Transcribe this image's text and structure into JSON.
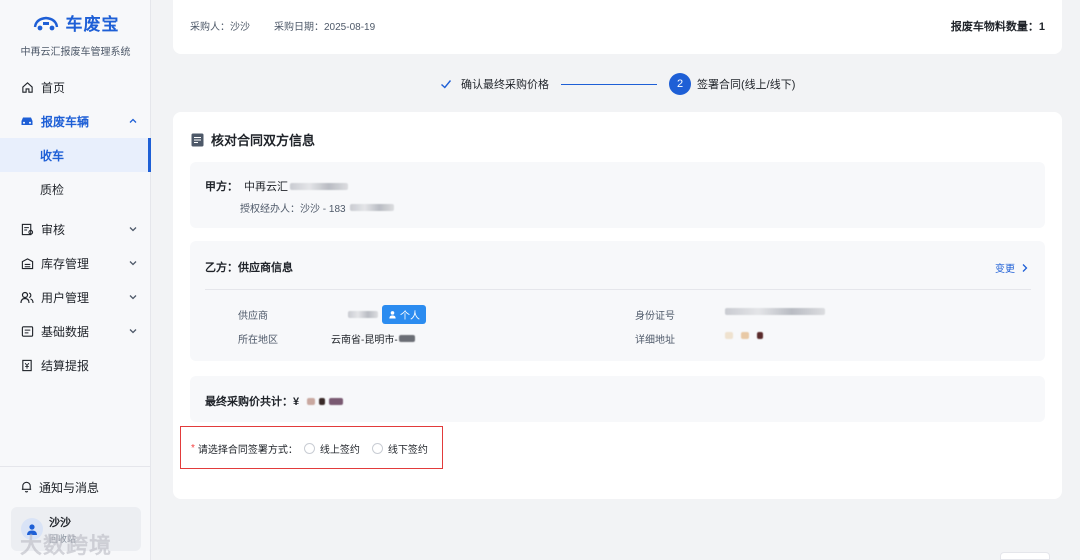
{
  "brand": {
    "name": "车废宝",
    "subtitle": "中再云汇报废车管理系统"
  },
  "nav": {
    "home": "首页",
    "scrap_vehicles": "报废车辆",
    "receive": "收车",
    "inspect": "质检",
    "audit": "审核",
    "inventory": "库存管理",
    "users": "用户管理",
    "basic_data": "基础数据",
    "settlement": "结算提报"
  },
  "notice": "通知与消息",
  "user": {
    "name": "沙沙",
    "role": "回收站"
  },
  "watermark": "大数跨境",
  "info_bar": {
    "buyer": "采购人：沙沙",
    "purchase_date": "采购日期：2025-08-19",
    "material_count": "报废车物料数量：1"
  },
  "steps": {
    "step1_label": "确认最终采购价格",
    "step2_num": "2",
    "step2_label": "签署合同(线上/线下)"
  },
  "card": {
    "title": "核对合同双方信息",
    "party_a_label": "甲方：",
    "party_a_name": "中再云汇",
    "party_a_agent": "授权经办人：沙沙 -  183",
    "party_b_title": "乙方：供应商信息",
    "change": "变更",
    "supplier_label": "供应商",
    "personal_tag": "个人",
    "id_label": "身份证号",
    "region_label": "所在地区",
    "region_value": "云南省-昆明市-",
    "address_label": "详细地址",
    "price_label": "最终采购价共计：¥",
    "sign_required": "*",
    "sign_label": "请选择合同签署方式：",
    "online": "线上签约",
    "offline": "线下签约"
  }
}
